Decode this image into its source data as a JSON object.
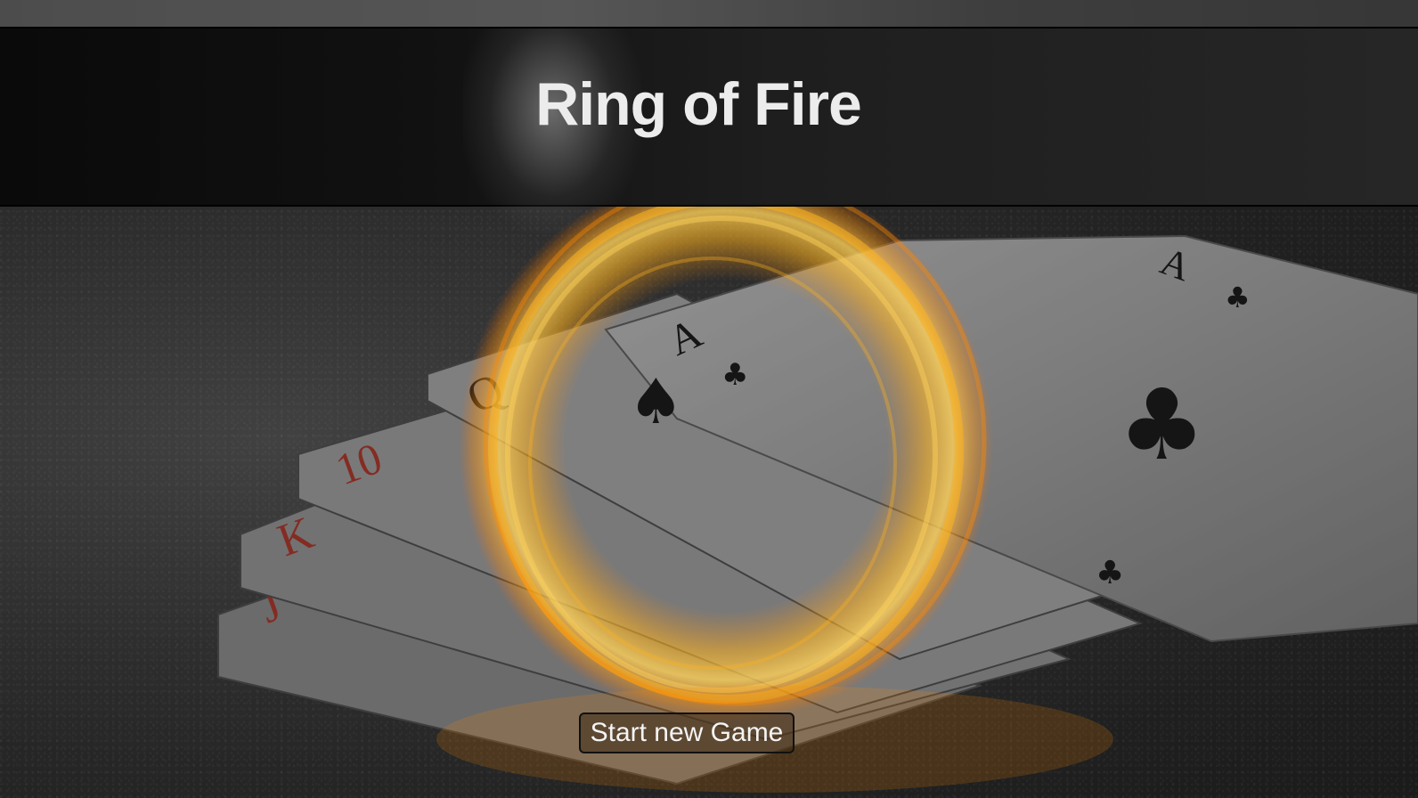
{
  "header": {
    "title": "Ring of Fire"
  },
  "actions": {
    "start_label": "Start new Game"
  },
  "scene": {
    "background_icon": "playing-cards-on-table",
    "overlay_icon": "fire-ring",
    "fire_color": "#ffb21e",
    "card_face_color": "#d9d9d9",
    "red_suit_color": "#c0392b",
    "black_suit_color": "#161616"
  }
}
